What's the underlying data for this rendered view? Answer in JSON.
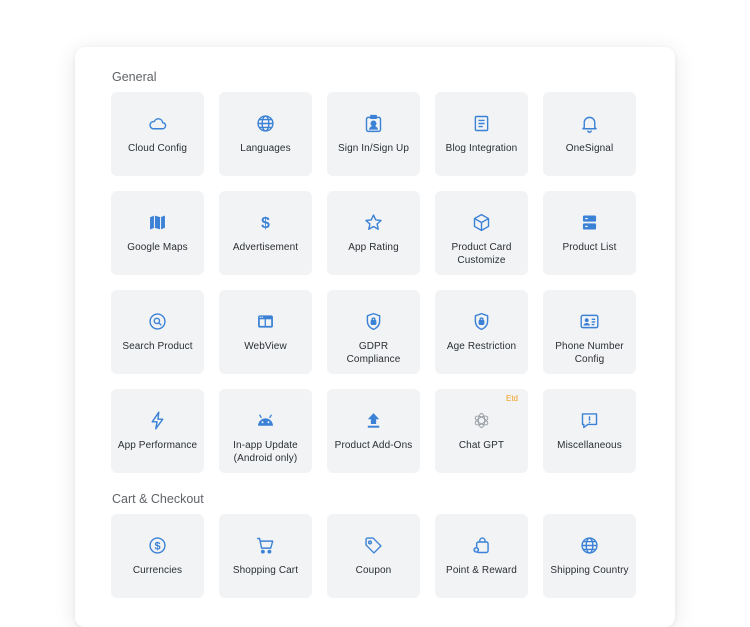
{
  "sections": {
    "general": "General",
    "cart": "Cart & Checkout"
  },
  "general_items": [
    {
      "label": "Cloud Config",
      "icon": "cloud-icon"
    },
    {
      "label": "Languages",
      "icon": "globe-icon"
    },
    {
      "label": "Sign In/Sign Up",
      "icon": "user-badge-icon"
    },
    {
      "label": "Blog Integration",
      "icon": "document-icon"
    },
    {
      "label": "OneSignal",
      "icon": "bell-icon"
    },
    {
      "label": "Google Maps",
      "icon": "map-icon"
    },
    {
      "label": "Advertisement",
      "icon": "dollar-icon"
    },
    {
      "label": "App Rating",
      "icon": "star-icon"
    },
    {
      "label": "Product Card Customize",
      "icon": "cube-icon"
    },
    {
      "label": "Product List",
      "icon": "list-icon"
    },
    {
      "label": "Search Product",
      "icon": "search-icon"
    },
    {
      "label": "WebView",
      "icon": "browser-window-icon"
    },
    {
      "label": "GDPR Compliance",
      "icon": "shield-lock-icon"
    },
    {
      "label": "Age Restriction",
      "icon": "shield-lock-icon"
    },
    {
      "label": "Phone Number Config",
      "icon": "contact-card-icon"
    },
    {
      "label": "App Performance",
      "icon": "lightning-icon"
    },
    {
      "label": "In-app Update (Android only)",
      "icon": "android-icon"
    },
    {
      "label": "Product Add-Ons",
      "icon": "upload-arrow-icon"
    },
    {
      "label": "Chat GPT",
      "icon": "openai-icon",
      "badge": "Etd"
    },
    {
      "label": "Miscellaneous",
      "icon": "alert-chat-icon"
    }
  ],
  "cart_items": [
    {
      "label": "Currencies",
      "icon": "dollar-circle-icon"
    },
    {
      "label": "Shopping Cart",
      "icon": "cart-icon"
    },
    {
      "label": "Coupon",
      "icon": "tag-icon"
    },
    {
      "label": "Point & Reward",
      "icon": "gift-bag-icon"
    },
    {
      "label": "Shipping Country",
      "icon": "globe-icon"
    }
  ],
  "colors": {
    "accent": "#3b82d6",
    "tile_bg": "#f1f3f5",
    "badge": "#f0a020",
    "muted_icon": "#9aa0a6"
  }
}
